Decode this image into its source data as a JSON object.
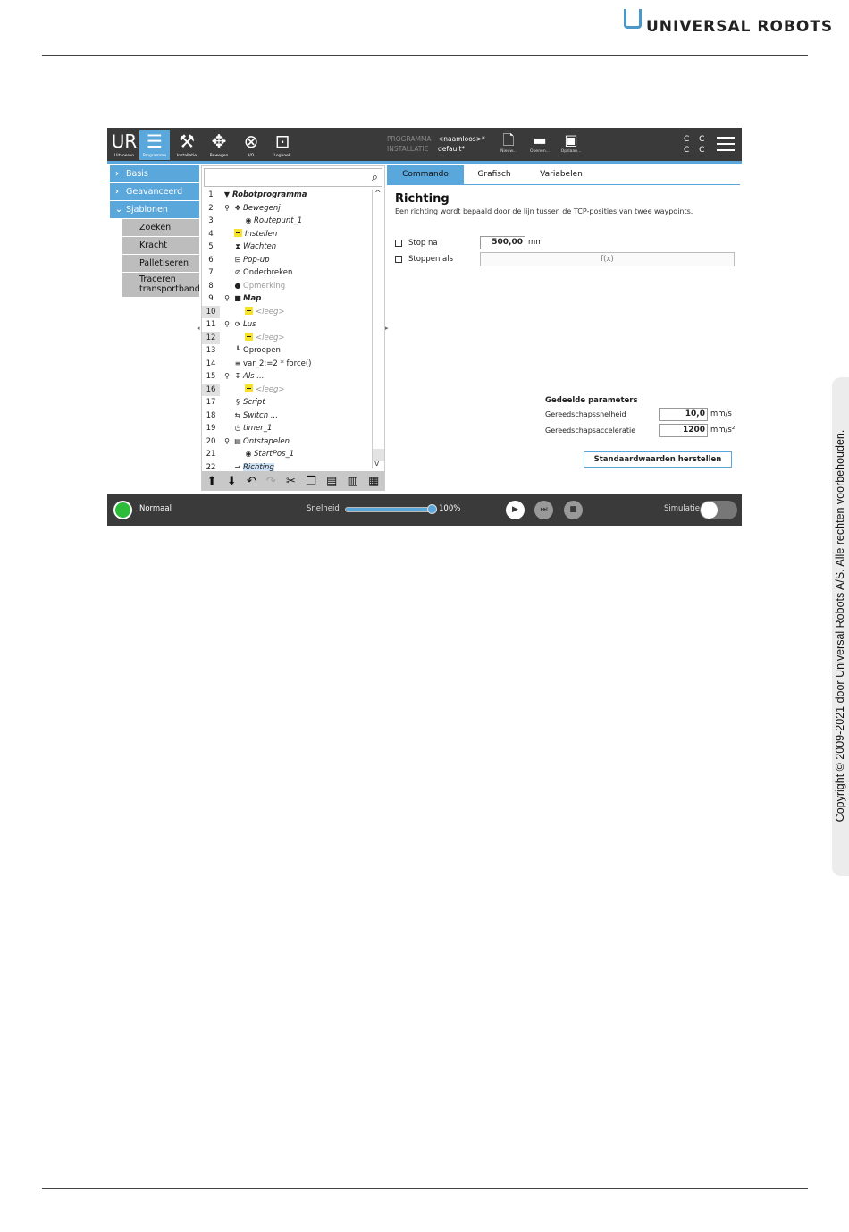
{
  "doc": {
    "brand": "UNIVERSAL ROBOTS",
    "copyright": "Copyright © 2009-2021 door Universal Robots A/S. Alle rechten voorbehouden."
  },
  "topbar": {
    "items": [
      {
        "label": "Uitvoeren",
        "icon": "run-logo-icon"
      },
      {
        "label": "Programma",
        "icon": "program-icon"
      },
      {
        "label": "Installatie",
        "icon": "installation-icon"
      },
      {
        "label": "Bewegen",
        "icon": "move-icon"
      },
      {
        "label": "I/O",
        "icon": "io-icon"
      },
      {
        "label": "Logboek",
        "icon": "log-icon"
      }
    ],
    "program_key": "PROGRAMMA",
    "program_value": "<naamloos>*",
    "install_key": "INSTALLATIE",
    "install_value": "default*",
    "new_label": "Nieuw...",
    "open_label": "Openen...",
    "save_label": "Opslaan...",
    "cc_top": "C C",
    "cc_bottom": "C C"
  },
  "nav": {
    "basis": "Basis",
    "geavanceerd": "Geavanceerd",
    "sjablonen": "Sjablonen",
    "subs": [
      "Zoeken",
      "Kracht",
      "Palletiseren"
    ],
    "traceren_1": "Traceren",
    "traceren_2": "transportband"
  },
  "tree": {
    "rows": [
      {
        "num": "1",
        "label": "Robotprogramma"
      },
      {
        "num": "2",
        "label": "Bewegenj"
      },
      {
        "num": "3",
        "label": "Routepunt_1"
      },
      {
        "num": "4",
        "label": "Instellen"
      },
      {
        "num": "5",
        "label": "Wachten"
      },
      {
        "num": "6",
        "label": "Pop-up"
      },
      {
        "num": "7",
        "label": "Onderbreken"
      },
      {
        "num": "8",
        "label": "Opmerking"
      },
      {
        "num": "9",
        "label": "Map"
      },
      {
        "num": "10",
        "label": "<leeg>"
      },
      {
        "num": "11",
        "label": "Lus"
      },
      {
        "num": "12",
        "label": "<leeg>"
      },
      {
        "num": "13",
        "label": "Oproepen"
      },
      {
        "num": "14",
        "label": "var_2:=2 * force()"
      },
      {
        "num": "15",
        "label": "Als ..."
      },
      {
        "num": "16",
        "label": "<leeg>"
      },
      {
        "num": "17",
        "label": "Script"
      },
      {
        "num": "18",
        "label": "Switch ..."
      },
      {
        "num": "19",
        "label": "timer_1"
      },
      {
        "num": "20",
        "label": "Ontstapelen"
      },
      {
        "num": "21",
        "label": "StartPos_1"
      },
      {
        "num": "22",
        "label": "Richting"
      }
    ]
  },
  "tabs": [
    "Commando",
    "Grafisch",
    "Variabelen"
  ],
  "command": {
    "title": "Richting",
    "description": "Een richting wordt bepaald door de lijn tussen de TCP-posities van twee waypoints.",
    "stop_after_label": "Stop na",
    "stop_after_value": "500,00",
    "stop_after_unit": "mm",
    "stop_if_label": "Stoppen als",
    "fx_placeholder": "f(x)",
    "shared_title": "Gedeelde parameters",
    "tool_speed_label": "Gereedschapssnelheid",
    "tool_speed_value": "10,0",
    "tool_speed_unit": "mm/s",
    "tool_accel_label": "Gereedschapsacceleratie",
    "tool_accel_value": "1200",
    "tool_accel_unit": "mm/s²",
    "reset_label": "Standaardwaarden herstellen"
  },
  "footer": {
    "status": "Normaal",
    "speed_label": "Snelheid",
    "speed_value": "100%",
    "speed_fraction": 1.0,
    "simulation_label": "Simulatie"
  },
  "colors": {
    "accent": "#5aa7dc",
    "status_green": "#2dbb3a",
    "bar": "#3a3a3a"
  }
}
